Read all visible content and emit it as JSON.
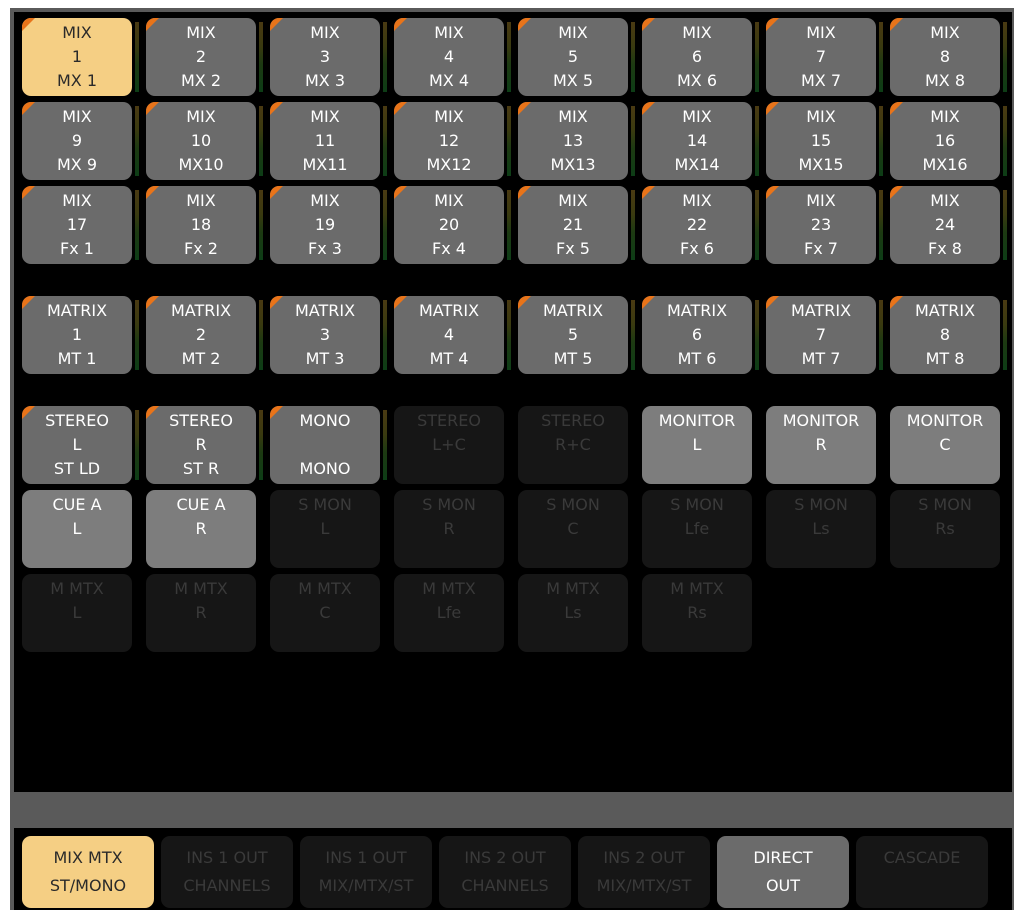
{
  "grid": {
    "rows": [
      [
        {
          "lines": [
            "MIX",
            "1",
            "MX 1"
          ],
          "state": "active",
          "tri": true,
          "meter": true
        },
        {
          "lines": [
            "MIX",
            "2",
            "MX 2"
          ],
          "state": "normal",
          "tri": true,
          "meter": true
        },
        {
          "lines": [
            "MIX",
            "3",
            "MX 3"
          ],
          "state": "normal",
          "tri": true,
          "meter": true
        },
        {
          "lines": [
            "MIX",
            "4",
            "MX 4"
          ],
          "state": "normal",
          "tri": true,
          "meter": true
        },
        {
          "lines": [
            "MIX",
            "5",
            "MX 5"
          ],
          "state": "normal",
          "tri": true,
          "meter": true
        },
        {
          "lines": [
            "MIX",
            "6",
            "MX 6"
          ],
          "state": "normal",
          "tri": true,
          "meter": true
        },
        {
          "lines": [
            "MIX",
            "7",
            "MX 7"
          ],
          "state": "normal",
          "tri": true,
          "meter": true
        },
        {
          "lines": [
            "MIX",
            "8",
            "MX 8"
          ],
          "state": "normal",
          "tri": true,
          "meter": true
        }
      ],
      [
        {
          "lines": [
            "MIX",
            "9",
            "MX 9"
          ],
          "state": "normal",
          "tri": true,
          "meter": true
        },
        {
          "lines": [
            "MIX",
            "10",
            "MX10"
          ],
          "state": "normal",
          "tri": true,
          "meter": true
        },
        {
          "lines": [
            "MIX",
            "11",
            "MX11"
          ],
          "state": "normal",
          "tri": true,
          "meter": true
        },
        {
          "lines": [
            "MIX",
            "12",
            "MX12"
          ],
          "state": "normal",
          "tri": true,
          "meter": true
        },
        {
          "lines": [
            "MIX",
            "13",
            "MX13"
          ],
          "state": "normal",
          "tri": true,
          "meter": true
        },
        {
          "lines": [
            "MIX",
            "14",
            "MX14"
          ],
          "state": "normal",
          "tri": true,
          "meter": true
        },
        {
          "lines": [
            "MIX",
            "15",
            "MX15"
          ],
          "state": "normal",
          "tri": true,
          "meter": true
        },
        {
          "lines": [
            "MIX",
            "16",
            "MX16"
          ],
          "state": "normal",
          "tri": true,
          "meter": true
        }
      ],
      [
        {
          "lines": [
            "MIX",
            "17",
            "Fx 1"
          ],
          "state": "normal",
          "tri": true,
          "meter": true
        },
        {
          "lines": [
            "MIX",
            "18",
            "Fx 2"
          ],
          "state": "normal",
          "tri": true,
          "meter": true
        },
        {
          "lines": [
            "MIX",
            "19",
            "Fx 3"
          ],
          "state": "normal",
          "tri": true,
          "meter": true
        },
        {
          "lines": [
            "MIX",
            "20",
            "Fx 4"
          ],
          "state": "normal",
          "tri": true,
          "meter": true
        },
        {
          "lines": [
            "MIX",
            "21",
            "Fx 5"
          ],
          "state": "normal",
          "tri": true,
          "meter": true
        },
        {
          "lines": [
            "MIX",
            "22",
            "Fx 6"
          ],
          "state": "normal",
          "tri": true,
          "meter": true
        },
        {
          "lines": [
            "MIX",
            "23",
            "Fx 7"
          ],
          "state": "normal",
          "tri": true,
          "meter": true
        },
        {
          "lines": [
            "MIX",
            "24",
            "Fx 8"
          ],
          "state": "normal",
          "tri": true,
          "meter": true
        }
      ],
      [
        {
          "lines": [
            "MATRIX",
            "1",
            "MT 1"
          ],
          "state": "normal",
          "tri": true,
          "meter": true
        },
        {
          "lines": [
            "MATRIX",
            "2",
            "MT 2"
          ],
          "state": "normal",
          "tri": true,
          "meter": true
        },
        {
          "lines": [
            "MATRIX",
            "3",
            "MT 3"
          ],
          "state": "normal",
          "tri": true,
          "meter": true
        },
        {
          "lines": [
            "MATRIX",
            "4",
            "MT 4"
          ],
          "state": "normal",
          "tri": true,
          "meter": true
        },
        {
          "lines": [
            "MATRIX",
            "5",
            "MT 5"
          ],
          "state": "normal",
          "tri": true,
          "meter": true
        },
        {
          "lines": [
            "MATRIX",
            "6",
            "MT 6"
          ],
          "state": "normal",
          "tri": true,
          "meter": true
        },
        {
          "lines": [
            "MATRIX",
            "7",
            "MT 7"
          ],
          "state": "normal",
          "tri": true,
          "meter": true
        },
        {
          "lines": [
            "MATRIX",
            "8",
            "MT 8"
          ],
          "state": "normal",
          "tri": true,
          "meter": true
        }
      ],
      [
        {
          "lines": [
            "STEREO",
            "L",
            "ST LD"
          ],
          "state": "normal",
          "tri": true,
          "meter": true
        },
        {
          "lines": [
            "STEREO",
            "R",
            "ST R"
          ],
          "state": "normal",
          "tri": true,
          "meter": true
        },
        {
          "lines": [
            "MONO",
            "",
            "MONO"
          ],
          "state": "normal",
          "tri": true,
          "meter": true
        },
        {
          "lines": [
            "STEREO",
            "L+C",
            ""
          ],
          "state": "disabled",
          "tri": false,
          "meter": false
        },
        {
          "lines": [
            "STEREO",
            "R+C",
            ""
          ],
          "state": "disabled",
          "tri": false,
          "meter": false
        },
        {
          "lines": [
            "MONITOR",
            "L",
            ""
          ],
          "state": "light",
          "tri": false,
          "meter": false
        },
        {
          "lines": [
            "MONITOR",
            "R",
            ""
          ],
          "state": "light",
          "tri": false,
          "meter": false
        },
        {
          "lines": [
            "MONITOR",
            "C",
            ""
          ],
          "state": "light",
          "tri": false,
          "meter": false
        }
      ],
      [
        {
          "lines": [
            "CUE A",
            "L",
            ""
          ],
          "state": "light",
          "tri": false,
          "meter": false
        },
        {
          "lines": [
            "CUE A",
            "R",
            ""
          ],
          "state": "light",
          "tri": false,
          "meter": false
        },
        {
          "lines": [
            "S MON",
            "L",
            ""
          ],
          "state": "disabled",
          "tri": false,
          "meter": false
        },
        {
          "lines": [
            "S MON",
            "R",
            ""
          ],
          "state": "disabled",
          "tri": false,
          "meter": false
        },
        {
          "lines": [
            "S MON",
            "C",
            ""
          ],
          "state": "disabled",
          "tri": false,
          "meter": false
        },
        {
          "lines": [
            "S MON",
            "Lfe",
            ""
          ],
          "state": "disabled",
          "tri": false,
          "meter": false
        },
        {
          "lines": [
            "S MON",
            "Ls",
            ""
          ],
          "state": "disabled",
          "tri": false,
          "meter": false
        },
        {
          "lines": [
            "S MON",
            "Rs",
            ""
          ],
          "state": "disabled",
          "tri": false,
          "meter": false
        }
      ],
      [
        {
          "lines": [
            "M MTX",
            "L",
            ""
          ],
          "state": "disabled",
          "tri": false,
          "meter": false
        },
        {
          "lines": [
            "M MTX",
            "R",
            ""
          ],
          "state": "disabled",
          "tri": false,
          "meter": false
        },
        {
          "lines": [
            "M MTX",
            "C",
            ""
          ],
          "state": "disabled",
          "tri": false,
          "meter": false
        },
        {
          "lines": [
            "M MTX",
            "Lfe",
            ""
          ],
          "state": "disabled",
          "tri": false,
          "meter": false
        },
        {
          "lines": [
            "M MTX",
            "Ls",
            ""
          ],
          "state": "disabled",
          "tri": false,
          "meter": false
        },
        {
          "lines": [
            "M MTX",
            "Rs",
            ""
          ],
          "state": "disabled",
          "tri": false,
          "meter": false
        }
      ]
    ]
  },
  "tabs": [
    {
      "lines": [
        "MIX MTX",
        "ST/MONO"
      ],
      "state": "active"
    },
    {
      "lines": [
        "INS 1 OUT",
        "CHANNELS"
      ],
      "state": "disabled"
    },
    {
      "lines": [
        "INS 1 OUT",
        "MIX/MTX/ST"
      ],
      "state": "disabled"
    },
    {
      "lines": [
        "INS 2 OUT",
        "CHANNELS"
      ],
      "state": "disabled"
    },
    {
      "lines": [
        "INS 2 OUT",
        "MIX/MTX/ST"
      ],
      "state": "disabled"
    },
    {
      "lines": [
        "DIRECT",
        "OUT"
      ],
      "state": "normal"
    },
    {
      "lines": [
        "CASCADE",
        ""
      ],
      "state": "disabled"
    }
  ],
  "colors": {
    "active": "#f5cf84",
    "normal": "#6b6b6b",
    "light": "#7d7d7d",
    "disabled": "#161616",
    "indicator": "#e8741a",
    "background": "#000000"
  }
}
